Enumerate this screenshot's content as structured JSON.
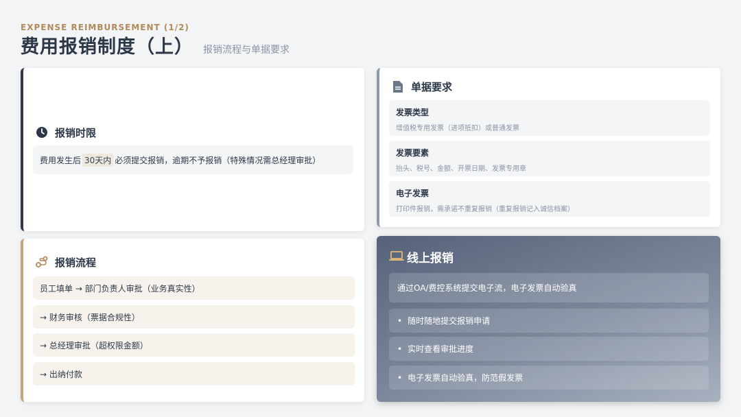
{
  "header": {
    "eyebrow": "EXPENSE REIMBURSEMENT (1/2)",
    "title": "费用报销制度（上）",
    "subtitle": "报销流程与单据要求"
  },
  "deadline": {
    "title": "报销时限",
    "icon": "clock-icon",
    "text_before": "费用发生后",
    "highlight": "30天内",
    "text_after": "必须提交报销，逾期不予报销（特殊情况需总经理审批）"
  },
  "process": {
    "title": "报销流程",
    "icon": "route-icon",
    "steps": [
      "员工填单 → 部门负责人审批（业务真实性）",
      "→ 财务审核（票据合规性）",
      "→ 总经理审批（超权限金额）",
      "→ 出纳付款"
    ]
  },
  "documents": {
    "title": "单据要求",
    "icon": "document-icon",
    "items": [
      {
        "title": "发票类型",
        "desc": "增值税专用发票（进项抵扣）或普通发票"
      },
      {
        "title": "发票要素",
        "desc": "抬头、税号、金额、开票日期、发票专用章"
      },
      {
        "title": "电子发票",
        "desc": "打印件报销，需承诺不重复报销（重复报销记入诚信档案）"
      }
    ]
  },
  "online": {
    "title": "线上报销",
    "icon": "laptop-icon",
    "main": "通过OA/费控系统提交电子流，电子发票自动验真",
    "items": [
      "随时随地提交报销申请",
      "实时查看审批进度",
      "电子发票自动验真，防范假发票"
    ]
  },
  "colors": {
    "navy": "#2e3a4c",
    "gold": "#c4a47c",
    "gray": "#8f9aad"
  }
}
